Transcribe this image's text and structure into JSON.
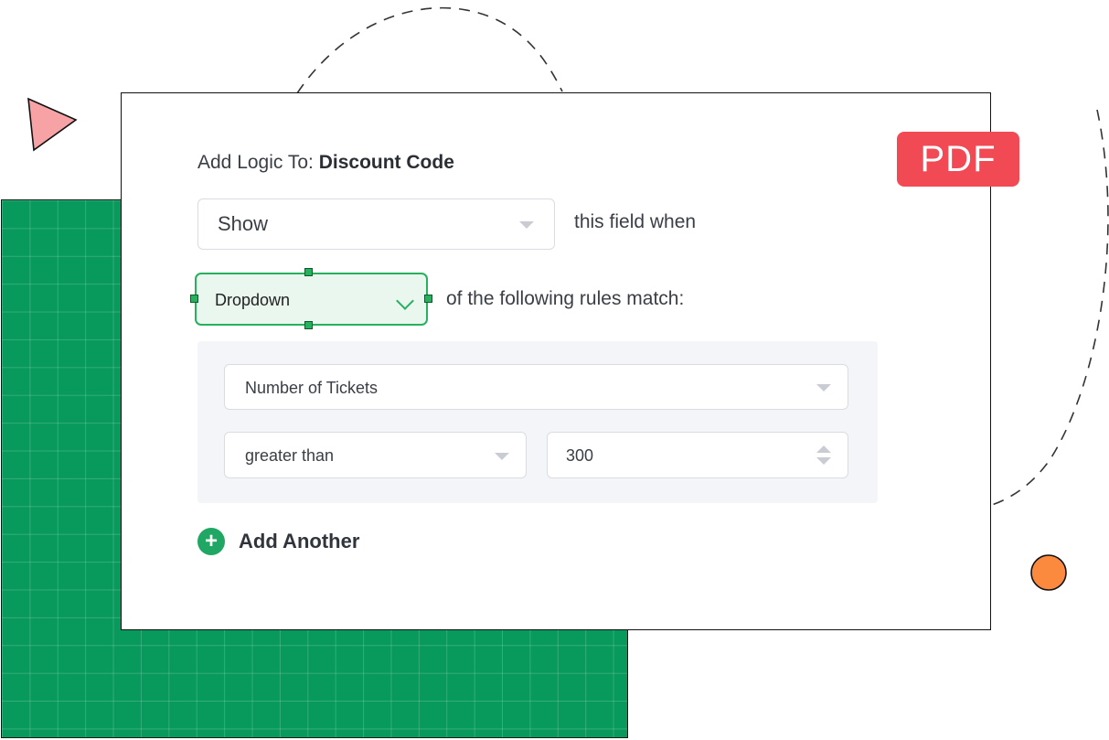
{
  "logic_title": {
    "prefix": "Add Logic To:",
    "field_name": "Discount Code"
  },
  "badge": {
    "label": "PDF",
    "color": "#f24a55"
  },
  "action_select": {
    "value": "Show"
  },
  "action_suffix": "this field when",
  "match_select": {
    "value": "Dropdown"
  },
  "match_suffix": "of the following rules match:",
  "rule": {
    "field_select": {
      "value": "Number of Tickets"
    },
    "operator_select": {
      "value": "greater than"
    },
    "value_input": {
      "value": "300"
    }
  },
  "add_another": {
    "label": "Add Another",
    "icon": "plus-circle-icon"
  },
  "colors": {
    "accent_green": "#27b05e",
    "grid_green": "#079a5c",
    "triangle": "#f7a3a6",
    "circle": "#fb8a3e"
  }
}
